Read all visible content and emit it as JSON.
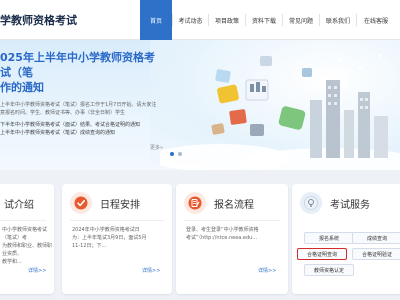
{
  "header": {
    "site_title": "学教师资格考试",
    "nav": [
      {
        "label": "首页",
        "active": true
      },
      {
        "label": "考试动态",
        "active": false
      },
      {
        "label": "项目政策",
        "active": false
      },
      {
        "label": "资料下载",
        "active": false
      },
      {
        "label": "常见问题",
        "active": false
      },
      {
        "label": "联系我们",
        "active": false
      },
      {
        "label": "在线客服",
        "active": false
      }
    ]
  },
  "hero": {
    "title_line1": "025年上半年中小学教师资格考试（笔",
    "title_line2": "作的通知",
    "paragraph": "上半年中小学教师资格考试（笔试）报名工作于1月7日开始。请大家注意报名时间。学生、教师证书等、办事（非全日制）学生",
    "list_line1": "下半年中小学教师资格考试（面试）结果、考试合格证明的通知",
    "list_line2": "上半年中小学教师资格考试（笔试）成绩查询的通知",
    "more": "更多»"
  },
  "cards": {
    "intro": {
      "title": "试介绍",
      "body_line1": "中小学教师资格考试（笔试）考",
      "body_line2": "为教师和职业、教师职业资质、",
      "body_line3": "教学和...",
      "more": "详情>>"
    },
    "schedule": {
      "title": "日程安排",
      "body_line1": "2024年中小学教师资格考试日",
      "body_line2": "为：上半年笔试3月9日，面试5月",
      "body_line3": "11-12日；下...",
      "more": "详情>>"
    },
    "registration": {
      "title": "报名流程",
      "body_line1": "登录、考生登录“中小学教师资格",
      "body_line2": "考试”（http://ntce.neea.edu...",
      "more": "详情>>"
    },
    "service": {
      "title": "考试服务",
      "buttons": [
        "报名系统",
        "成绩查询",
        "合格证明查询",
        "合格证明验证",
        "教师资格认定"
      ]
    }
  }
}
